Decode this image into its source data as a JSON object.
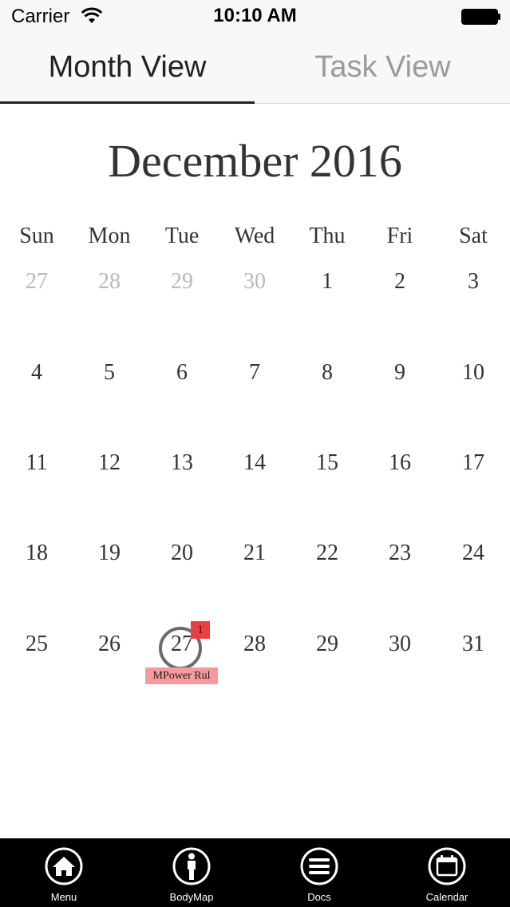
{
  "status_bar": {
    "carrier": "Carrier",
    "time": "10:10 AM"
  },
  "tabs": [
    {
      "label": "Month View",
      "selected": true
    },
    {
      "label": "Task View",
      "selected": false
    }
  ],
  "calendar": {
    "title": "December 2016",
    "weekdays": [
      "Sun",
      "Mon",
      "Tue",
      "Wed",
      "Thu",
      "Fri",
      "Sat"
    ],
    "weeks": [
      [
        {
          "d": "27",
          "muted": true
        },
        {
          "d": "28",
          "muted": true
        },
        {
          "d": "29",
          "muted": true
        },
        {
          "d": "30",
          "muted": true
        },
        {
          "d": "1"
        },
        {
          "d": "2"
        },
        {
          "d": "3"
        }
      ],
      [
        {
          "d": "4"
        },
        {
          "d": "5"
        },
        {
          "d": "6"
        },
        {
          "d": "7"
        },
        {
          "d": "8"
        },
        {
          "d": "9"
        },
        {
          "d": "10"
        }
      ],
      [
        {
          "d": "11"
        },
        {
          "d": "12"
        },
        {
          "d": "13"
        },
        {
          "d": "14"
        },
        {
          "d": "15"
        },
        {
          "d": "16"
        },
        {
          "d": "17"
        }
      ],
      [
        {
          "d": "18"
        },
        {
          "d": "19"
        },
        {
          "d": "20"
        },
        {
          "d": "21"
        },
        {
          "d": "22"
        },
        {
          "d": "23"
        },
        {
          "d": "24"
        }
      ],
      [
        {
          "d": "25"
        },
        {
          "d": "26"
        },
        {
          "d": "27",
          "today": true
        },
        {
          "d": "28"
        },
        {
          "d": "29"
        },
        {
          "d": "30"
        },
        {
          "d": "31"
        }
      ]
    ],
    "event": {
      "count": "1",
      "title": "MPower Rul"
    },
    "colors": {
      "badge": "#ef3d45",
      "chip": "#f59a9e",
      "muted_day": "#b8b8b8"
    }
  },
  "bottom_nav": [
    {
      "label": "Menu",
      "icon": "home-icon"
    },
    {
      "label": "BodyMap",
      "icon": "person-icon"
    },
    {
      "label": "Docs",
      "icon": "list-icon"
    },
    {
      "label": "Calendar",
      "icon": "calendar-icon"
    }
  ]
}
